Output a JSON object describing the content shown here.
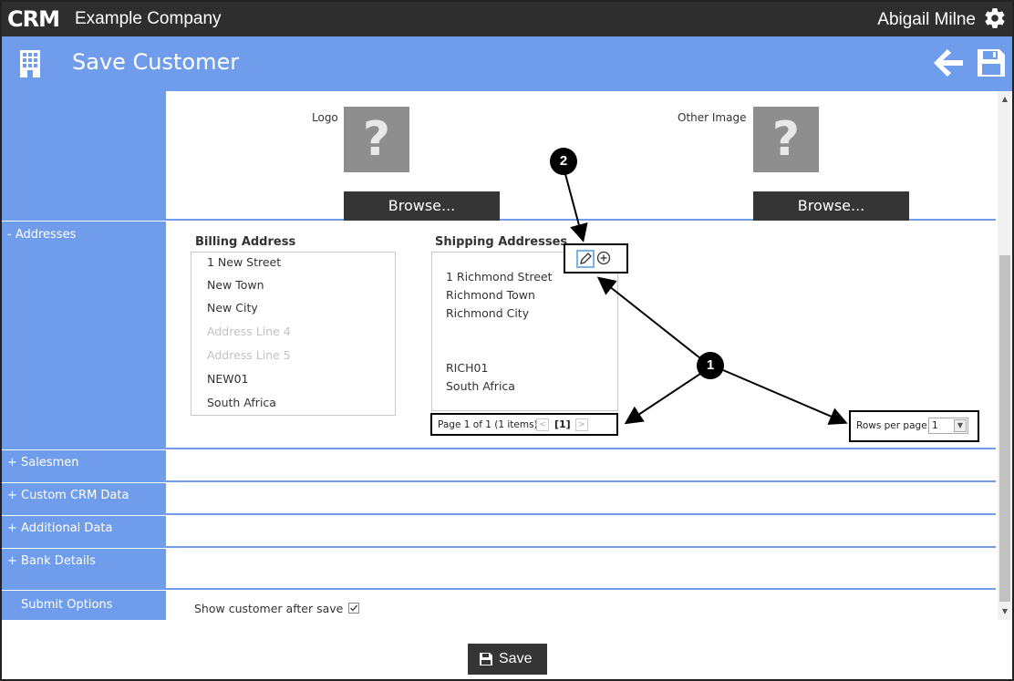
{
  "topbar": {
    "logo_text": "CRM",
    "company": "Example Company",
    "user": "Abigail Milne",
    "settings_icon": "gear-icon"
  },
  "header": {
    "title": "Save Customer",
    "page_icon": "building-icon",
    "back_icon": "back-arrow-icon",
    "save_icon": "floppy-disk-icon"
  },
  "images": {
    "logo_label": "Logo",
    "other_label": "Other Image",
    "placeholder_glyph": "?",
    "browse_label": "Browse..."
  },
  "sections": {
    "addresses": "- Addresses",
    "salesmen": "+ Salesmen",
    "custom_crm": "+ Custom CRM Data",
    "additional": "+ Additional Data",
    "bank": "+ Bank Details",
    "submit": "Submit Options"
  },
  "billing": {
    "title": "Billing Address",
    "lines": [
      {
        "text": "1 New Street",
        "placeholder": false
      },
      {
        "text": "New Town",
        "placeholder": false
      },
      {
        "text": "New City",
        "placeholder": false
      },
      {
        "text": "Address Line 4",
        "placeholder": true
      },
      {
        "text": "Address Line 5",
        "placeholder": true
      },
      {
        "text": "NEW01",
        "placeholder": false
      },
      {
        "text": "South Africa",
        "placeholder": false
      }
    ]
  },
  "shipping": {
    "title": "Shipping Addresses",
    "lines": [
      "1 Richmond Street",
      "Richmond Town",
      "Richmond City",
      "",
      "",
      "RICH01",
      "South Africa"
    ],
    "pager_text": "Page 1 of 1 (1 items)",
    "current_page": "[1]",
    "prev_glyph": "<",
    "next_glyph": ">"
  },
  "rows_per_page": {
    "label": "Rows per page:",
    "value": "1"
  },
  "badges": {
    "one": "1",
    "two": "2"
  },
  "submit_options": {
    "show_after_save_label": "Show customer after save",
    "show_after_save_checked": true
  },
  "footer": {
    "save_label": "Save"
  }
}
